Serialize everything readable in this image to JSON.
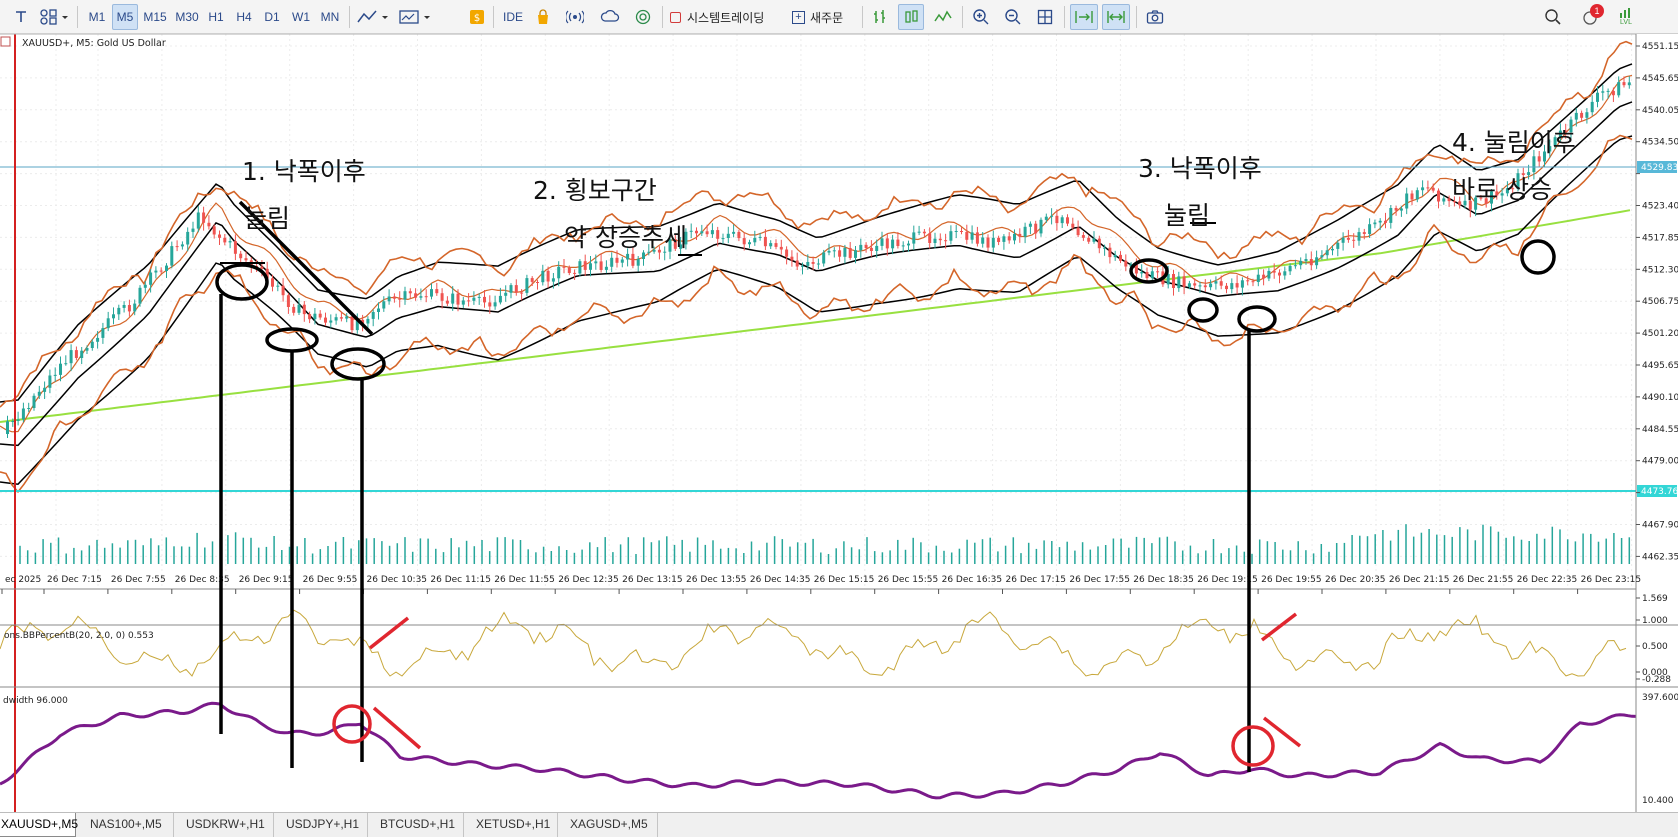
{
  "toolbar": {
    "timeframes": [
      "M1",
      "M5",
      "M15",
      "M30",
      "H1",
      "H4",
      "D1",
      "W1",
      "MN"
    ],
    "active_timeframe": "M5",
    "ide_label": "IDE",
    "algo_trading_label": "시스템트레이딩",
    "new_order_label": "새주문",
    "notification_badge": "1",
    "lvl_label": "LVL",
    "icons": [
      "text-tool-icon",
      "objects-icon",
      "indicators-icon",
      "chart-type-icon",
      "templates-icon",
      "market-icon",
      "ide-icon",
      "shop-icon",
      "signals-icon",
      "vps-icon",
      "browser-icon",
      "algo-trading-icon",
      "new-order-icon",
      "depth-icon",
      "bar-chart-icon",
      "line-chart-icon",
      "zoom-in-icon",
      "zoom-out-icon",
      "tile-windows-icon",
      "autoscroll-icon",
      "chart-shift-icon",
      "screenshot-icon",
      "search-icon",
      "notifications-icon",
      "lvl-icon"
    ]
  },
  "chart": {
    "symbol_label": "XAUUSD+, M5:  Gold US Dollar",
    "price_ticks": [
      "4551.15",
      "4545.65",
      "4540.05",
      "4534.50",
      "4529.83",
      "4523.40",
      "4517.85",
      "4512.30",
      "4506.75",
      "4501.20",
      "4495.65",
      "4490.10",
      "4484.55",
      "4479.00",
      "4473.76",
      "4467.90",
      "4462.35"
    ],
    "current_price_label": "4529.83",
    "bid_line_label": "4473.76",
    "time_ticks": [
      "ec 2025",
      "26 Dec 7:15",
      "26 Dec 7:55",
      "26 Dec 8:35",
      "26 Dec 9:15",
      "26 Dec 9:55",
      "26 Dec 10:35",
      "26 Dec 11:15",
      "26 Dec 11:55",
      "26 Dec 12:35",
      "26 Dec 13:15",
      "26 Dec 13:55",
      "26 Dec 14:35",
      "26 Dec 15:15",
      "26 Dec 15:55",
      "26 Dec 16:35",
      "26 Dec 17:15",
      "26 Dec 17:55",
      "26 Dec 18:35",
      "26 Dec 19:15",
      "26 Dec 19:55",
      "26 Dec 20:35",
      "26 Dec 21:15",
      "26 Dec 21:55",
      "26 Dec 22:35",
      "26 Dec 23:15"
    ],
    "annotations": [
      {
        "line1": "1. 낙폭이후",
        "line2": "눌림"
      },
      {
        "line1": "2. 횡보구간",
        "line2": "약 상승추세"
      },
      {
        "line1": "3. 낙폭이후",
        "line2": "눌림"
      },
      {
        "line1": "4. 눌림이후",
        "line2": "바로 상승"
      }
    ],
    "bbpercent": {
      "label": "ons.BBPercentB(20, 2.0, 0) 0.553",
      "ticks": [
        "1.569",
        "1.000",
        "0.500",
        "0.000",
        "-0.288"
      ]
    },
    "bandwidth": {
      "label": "dwidth 96.000",
      "ticks": [
        "397.600",
        "10.400"
      ]
    },
    "colors": {
      "bull": "#26a69a",
      "bear": "#ef5350",
      "envelope": "#d4662a",
      "bands": "#000000",
      "ma": "#98e040",
      "bid_line": "#33d6d6",
      "ask_line": "#5aa6c6",
      "percent_b": "#c8a83c",
      "bandwidth_line": "#7a1a8a",
      "marker_red": "#e0262f",
      "price_tag_blue": "#58b8d8"
    }
  },
  "tabs": [
    "XAUUSD+,M5",
    "NAS100+,M5",
    "USDKRW+,H1",
    "USDJPY+,H1",
    "BTCUSD+,H1",
    "XETUSD+,H1",
    "XAGUSD+,M5"
  ],
  "active_tab": "XAUUSD+,M5"
}
